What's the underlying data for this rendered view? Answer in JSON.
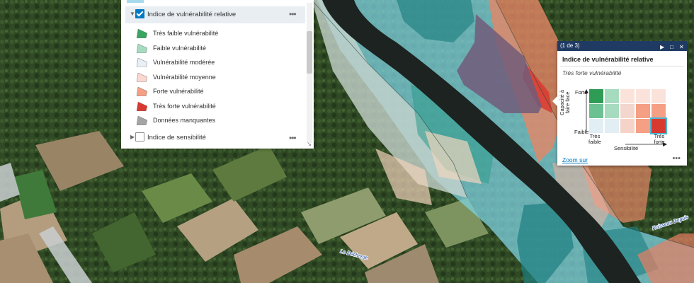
{
  "layer_list": {
    "layer1": {
      "title": "Indice de vulnérabilité relative",
      "checked": true
    },
    "legend": [
      {
        "label": "Très faible vulnérabilité",
        "color": "#3aa561"
      },
      {
        "label": "Faible vulnérabilité",
        "color": "#a6dbc0"
      },
      {
        "label": "Vulnérabilité modérée",
        "color": "#e8eff6"
      },
      {
        "label": "Vulnérabilité moyenne",
        "color": "#fad7cf"
      },
      {
        "label": "Forte vulnérabilité",
        "color": "#f59f85"
      },
      {
        "label": "Très forte vulnérabilité",
        "color": "#d93a30"
      },
      {
        "label": "Données manquantes",
        "color": "#a4a4a4"
      }
    ],
    "layer2": {
      "title": "Indice de sensibilité",
      "checked": false
    },
    "more_icon": "ellipsis-icon"
  },
  "popup": {
    "counter": "(1 de 3)",
    "title": "Indice de vulnérabilité relative",
    "subtitle": "Très forte vulnérabilité",
    "y_axis_label": "Capacité à faire face",
    "y_high": "Forte",
    "y_low": "Faible",
    "x_axis_label": "Sensibilité",
    "x_low": "Très faible",
    "x_high": "Très forte",
    "matrix_colors": [
      [
        "#2e9c55",
        "#a6dbc0",
        "#fbe3dc",
        "#fbe3dc",
        "#fbe3dc"
      ],
      [
        "#6cc193",
        "#a6dbc0",
        "#f3d7cf",
        "#f59f85",
        "#f59f85"
      ],
      [
        "#e1eef4",
        "#e1eef4",
        "#f6d3c9",
        "#f59f85",
        "#d93a30"
      ]
    ],
    "selected_cell": [
      2,
      4
    ],
    "zoom_label": "Zoom sur"
  },
  "map_labels": {
    "stream1": "Le Décharge",
    "stream2": "Ruisseau Dupuis"
  }
}
